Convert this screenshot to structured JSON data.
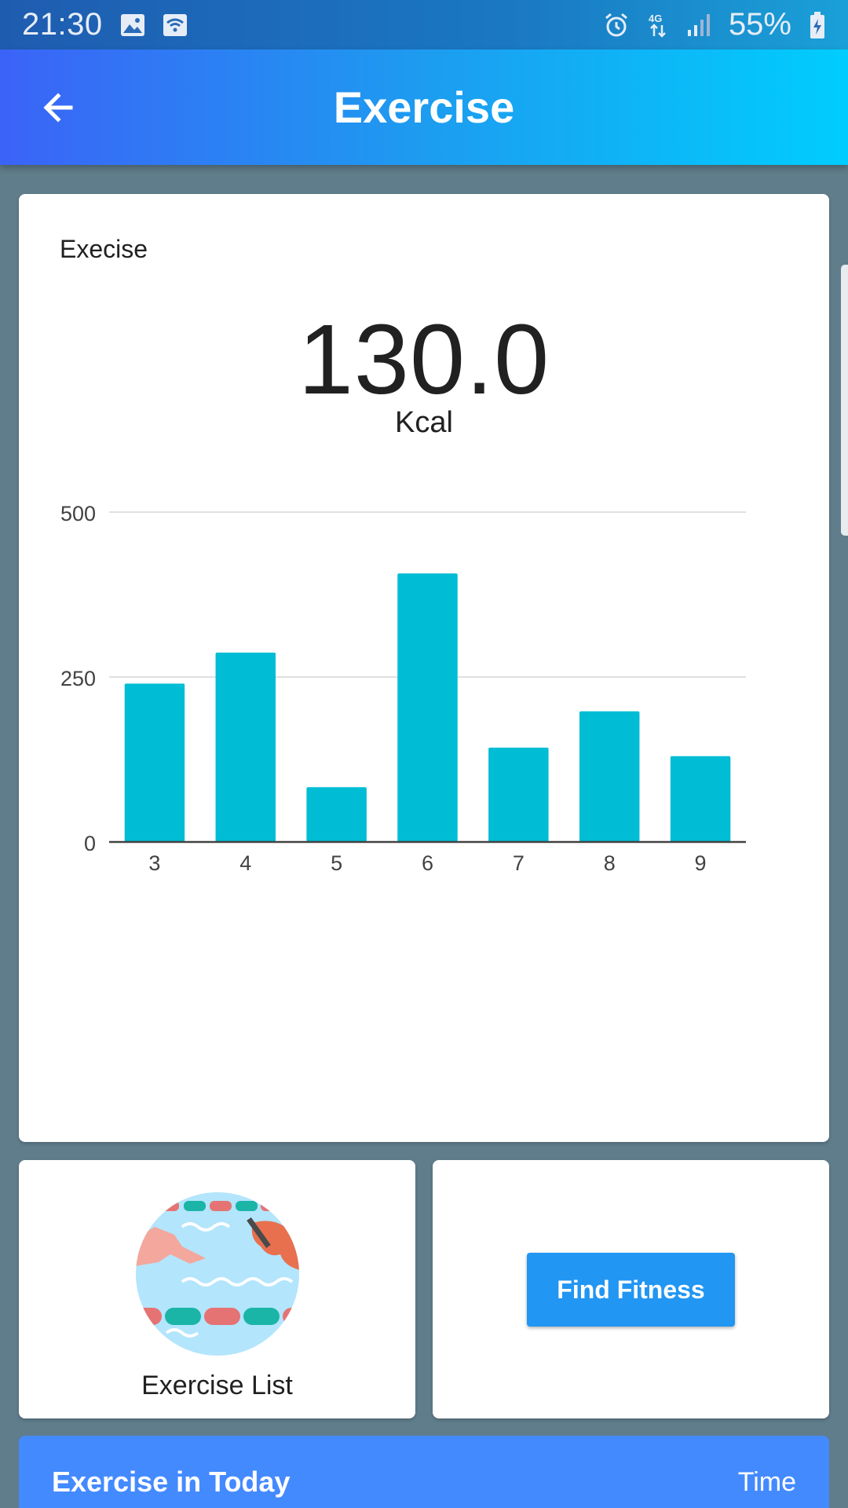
{
  "status_bar": {
    "time": "21:30",
    "battery_percent": "55%",
    "icons": [
      "image-icon",
      "wifi-icon",
      "alarm-icon",
      "network-4g-icon",
      "signal-icon",
      "battery-charging-icon"
    ]
  },
  "app_bar": {
    "title": "Exercise",
    "back_icon": "arrow-back-icon"
  },
  "summary": {
    "label": "Execise",
    "value": "130.0",
    "unit": "Kcal"
  },
  "chart_data": {
    "type": "bar",
    "categories": [
      "3",
      "4",
      "5",
      "6",
      "7",
      "8",
      "9"
    ],
    "values": [
      240,
      287,
      83,
      407,
      143,
      198,
      130
    ],
    "y_ticks": [
      0,
      250,
      500
    ],
    "ylim": [
      0,
      500
    ],
    "grid": true,
    "color": "#00bcd4"
  },
  "tiles": {
    "exercise_list_label": "Exercise List",
    "exercise_list_icon": "swimming-pool-illustration",
    "find_fitness_label": "Find Fitness"
  },
  "today": {
    "title": "Exercise in Today",
    "time_label": "Time"
  },
  "colors": {
    "background": "#607d8b",
    "app_bar_gradient_start": "#3b63f7",
    "app_bar_gradient_end": "#00cdfd",
    "bar": "#00bcd4",
    "button": "#2196f3",
    "today_header": "#448aff"
  }
}
